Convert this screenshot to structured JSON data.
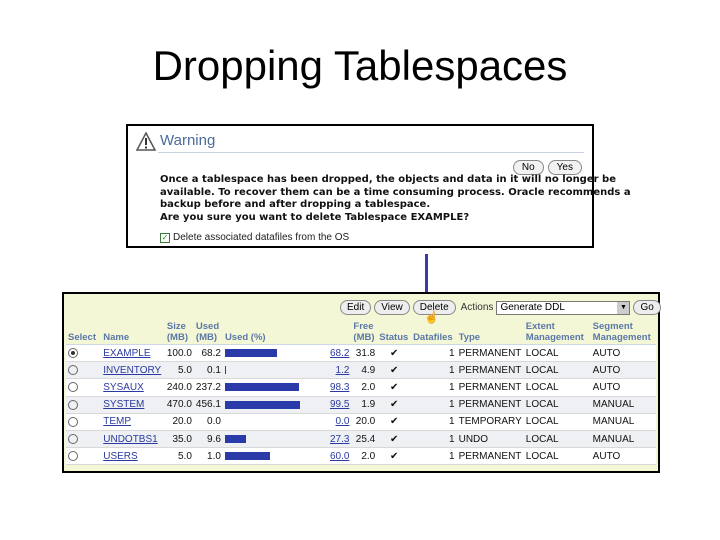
{
  "slide_title": "Dropping Tablespaces",
  "warning": {
    "title": "Warning",
    "no_label": "No",
    "yes_label": "Yes",
    "message_lines": [
      "Once a tablespace has been dropped, the objects and data in it will no longer be",
      "available. To recover them can be a time consuming process. Oracle recommends a",
      "backup before and after dropping a tablespace.",
      "Are you sure you want to delete Tablespace EXAMPLE?"
    ],
    "checkbox_label": "Delete associated datafiles from the OS",
    "checkbox_checked": true
  },
  "toolbar": {
    "edit": "Edit",
    "view": "View",
    "delete": "Delete",
    "actions_label": "Actions",
    "actions_value": "Generate DDL",
    "go": "Go"
  },
  "table": {
    "headers": {
      "select": "Select",
      "name": "Name",
      "size": "Size (MB)",
      "used": "Used (MB)",
      "used_pct": "Used (%)",
      "free": "Free (MB)",
      "status": "Status",
      "datafiles": "Datafiles",
      "type": "Type",
      "extent": "Extent Management",
      "segment": "Segment Management"
    },
    "rows": [
      {
        "name": "EXAMPLE",
        "size": "100.0",
        "used": "68.2",
        "pct": 68.2,
        "pct_label": "68.2",
        "free": "31.8",
        "datafiles": "1",
        "type": "PERMANENT",
        "extent": "LOCAL",
        "segment": "AUTO",
        "selected": true
      },
      {
        "name": "INVENTORY",
        "size": "5.0",
        "used": "0.1",
        "pct": 1.2,
        "pct_label": "1.2",
        "free": "4.9",
        "datafiles": "1",
        "type": "PERMANENT",
        "extent": "LOCAL",
        "segment": "AUTO",
        "selected": false
      },
      {
        "name": "SYSAUX",
        "size": "240.0",
        "used": "237.2",
        "pct": 98.3,
        "pct_label": "98.3",
        "free": "2.0",
        "datafiles": "1",
        "type": "PERMANENT",
        "extent": "LOCAL",
        "segment": "AUTO",
        "selected": false
      },
      {
        "name": "SYSTEM",
        "size": "470.0",
        "used": "456.1",
        "pct": 99.5,
        "pct_label": "99.5",
        "free": "1.9",
        "datafiles": "1",
        "type": "PERMANENT",
        "extent": "LOCAL",
        "segment": "MANUAL",
        "selected": false
      },
      {
        "name": "TEMP",
        "size": "20.0",
        "used": "0.0",
        "pct": 0.0,
        "pct_label": "0.0",
        "free": "20.0",
        "datafiles": "1",
        "type": "TEMPORARY",
        "extent": "LOCAL",
        "segment": "MANUAL",
        "selected": false
      },
      {
        "name": "UNDOTBS1",
        "size": "35.0",
        "used": "9.6",
        "pct": 27.3,
        "pct_label": "27.3",
        "free": "25.4",
        "datafiles": "1",
        "type": "UNDO",
        "extent": "LOCAL",
        "segment": "MANUAL",
        "selected": false
      },
      {
        "name": "USERS",
        "size": "5.0",
        "used": "1.0",
        "pct": 60.0,
        "pct_label": "60.0",
        "free": "2.0",
        "datafiles": "1",
        "type": "PERMANENT",
        "extent": "LOCAL",
        "segment": "AUTO",
        "selected": false
      }
    ]
  }
}
